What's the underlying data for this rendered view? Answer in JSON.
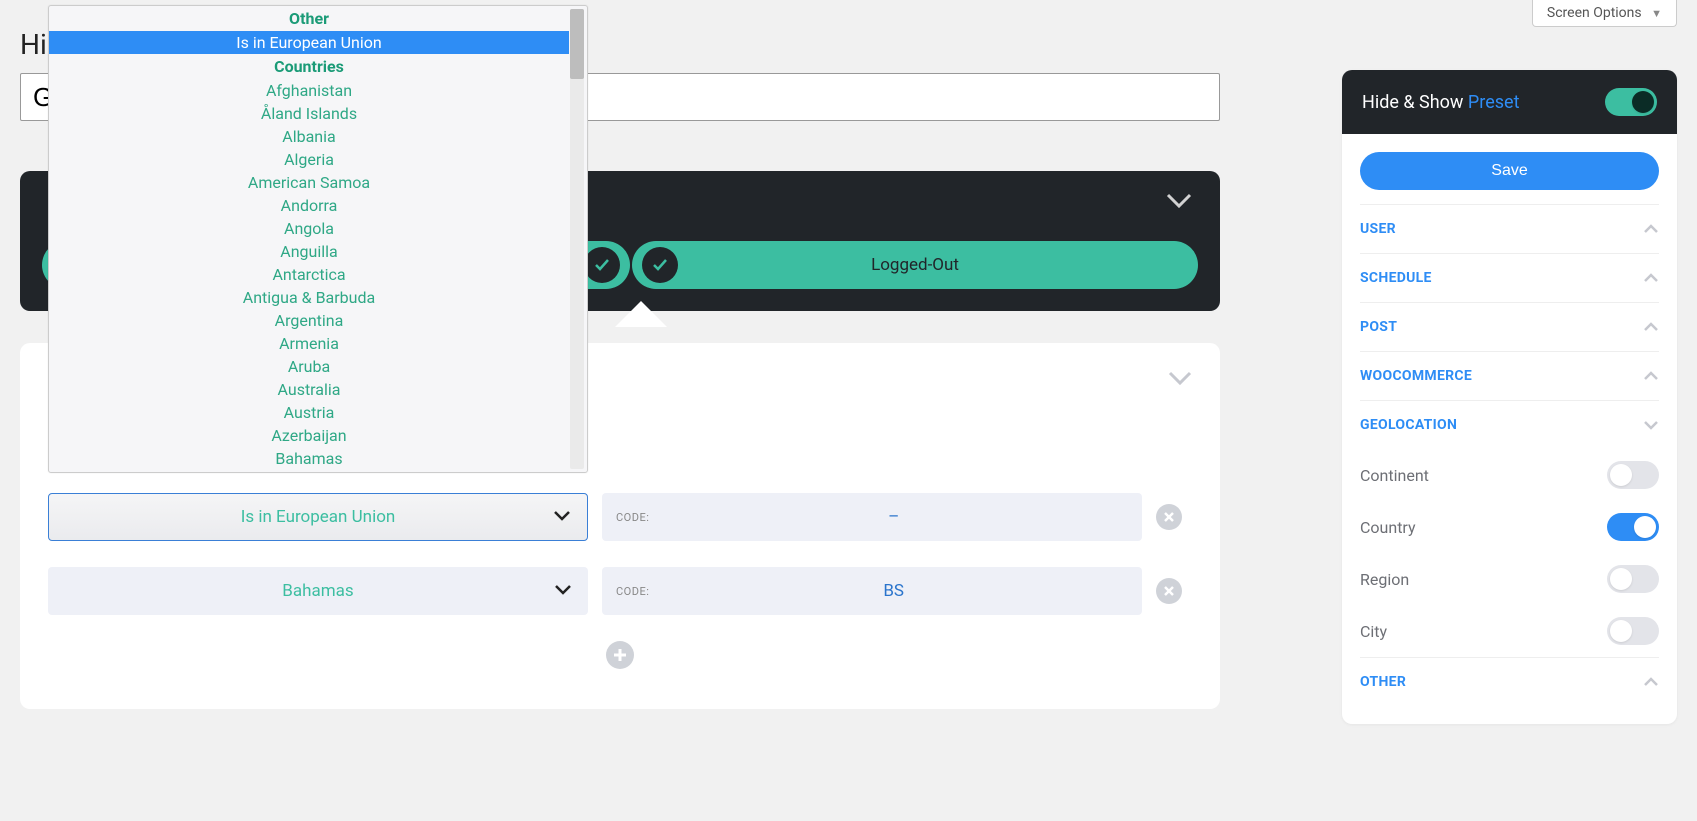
{
  "screen_options_label": "Screen Options",
  "page_title_visible": "Hi",
  "name_input_value": "G",
  "logged_out_label": "Logged-Out",
  "sidebar": {
    "header_title_a": "Hide & Show ",
    "header_title_b": "Preset",
    "header_toggle_on": true,
    "save_label": "Save",
    "sections": {
      "user": {
        "label": "USER",
        "expanded": false
      },
      "schedule": {
        "label": "SCHEDULE",
        "expanded": false
      },
      "post": {
        "label": "POST",
        "expanded": false
      },
      "woocommerce": {
        "label": "WOOCOMMERCE",
        "expanded": false
      },
      "geolocation": {
        "label": "GEOLOCATION",
        "expanded": true
      },
      "other": {
        "label": "OTHER",
        "expanded": false
      }
    },
    "geo_items": {
      "continent": {
        "label": "Continent",
        "on": false
      },
      "country": {
        "label": "Country",
        "on": true
      },
      "region": {
        "label": "Region",
        "on": false
      },
      "city": {
        "label": "City",
        "on": false
      }
    }
  },
  "rows": [
    {
      "select_label": "Is in European Union",
      "code_label": "CODE:",
      "code_value": "–"
    },
    {
      "select_label": "Bahamas",
      "code_label": "CODE:",
      "code_value": "BS"
    }
  ],
  "dropdown": {
    "group_other": "Other",
    "group_countries": "Countries",
    "selected": "Is in European Union",
    "countries": [
      "Afghanistan",
      "Åland Islands",
      "Albania",
      "Algeria",
      "American Samoa",
      "Andorra",
      "Angola",
      "Anguilla",
      "Antarctica",
      "Antigua & Barbuda",
      "Argentina",
      "Armenia",
      "Aruba",
      "Australia",
      "Austria",
      "Azerbaijan",
      "Bahamas"
    ]
  }
}
